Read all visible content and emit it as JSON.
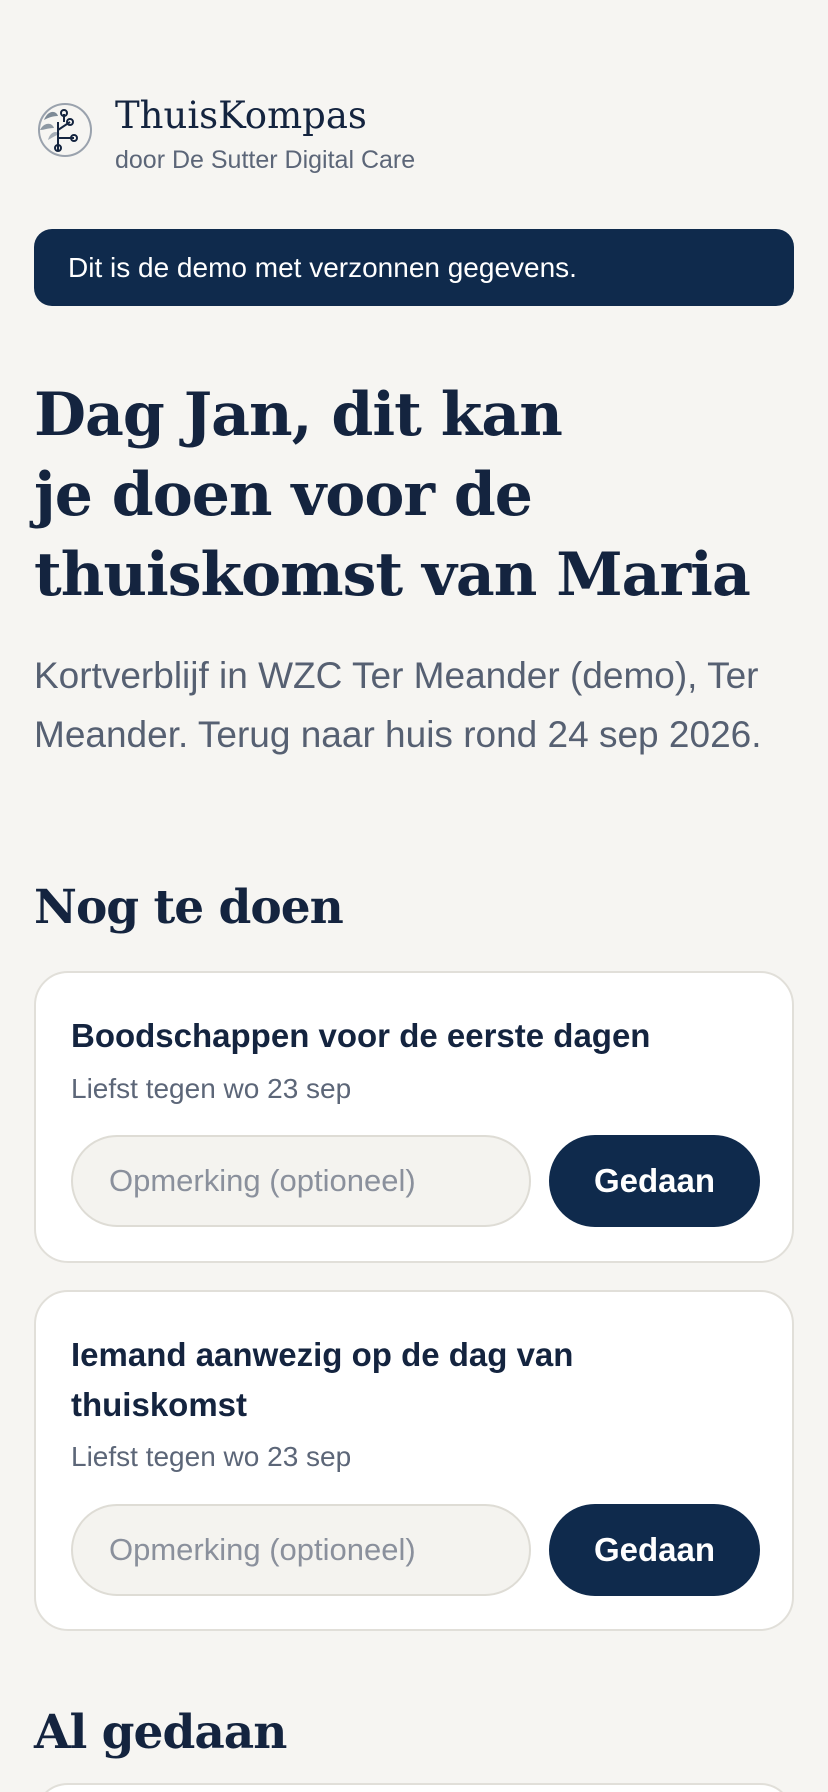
{
  "brand": {
    "name": "ThuisKompas",
    "subtitle": "door De Sutter Digital Care"
  },
  "banner": {
    "text": "Dit is de demo met verzonnen gegevens."
  },
  "headline": {
    "line1": "Dag Jan, dit kan",
    "line2": "je doen voor de",
    "line3": "thuiskomst van Maria"
  },
  "intro": {
    "text": "Kortverblijf in WZC Ter Meander (demo), Ter Meander. Terug naar huis rond 24 sep 2026."
  },
  "todo": {
    "title": "Nog te doen",
    "tasks": [
      {
        "title": "Boodschappen voor de eerste dagen",
        "due": "Liefst tegen wo 23 sep",
        "note_placeholder": "Opmerking (optioneel)",
        "note_value": "",
        "button_label": "Gedaan"
      },
      {
        "title": "Iemand aanwezig op de dag van thuiskomst",
        "due": "Liefst tegen wo 23 sep",
        "note_placeholder": "Opmerking (optioneel)",
        "note_value": "",
        "button_label": "Gedaan"
      }
    ]
  },
  "done": {
    "title": "Al gedaan"
  },
  "colors": {
    "background": "#f6f5f2",
    "primary": "#0f2a4c",
    "text": "#14243f",
    "muted": "#5c6678"
  },
  "icons": {
    "logo": "compass-tree-logo"
  }
}
